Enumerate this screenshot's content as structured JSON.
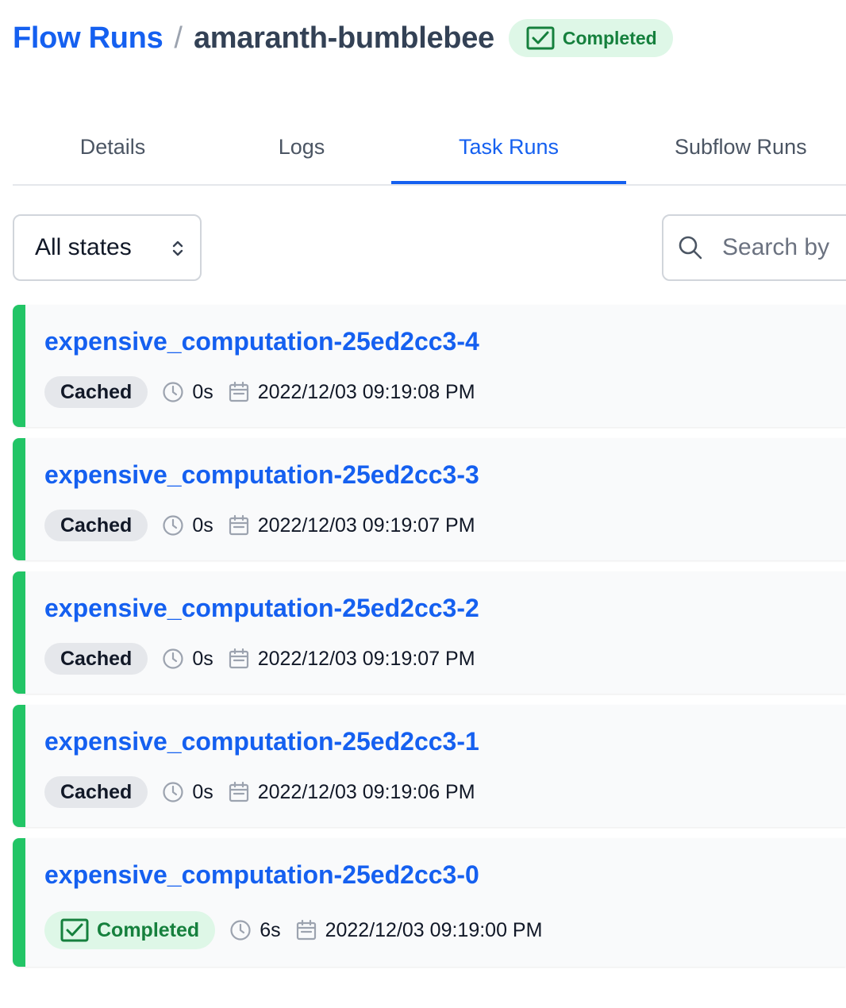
{
  "breadcrumb": {
    "parent": "Flow Runs",
    "separator": "/",
    "current": "amaranth-bumblebee",
    "state": "Completed"
  },
  "tabs": [
    {
      "label": "Details"
    },
    {
      "label": "Logs"
    },
    {
      "label": "Task Runs",
      "active": true
    },
    {
      "label": "Subflow Runs"
    }
  ],
  "filters": {
    "state_select": "All states",
    "search_placeholder": "Search by"
  },
  "task_runs": [
    {
      "name": "expensive_computation-25ed2cc3-4",
      "state": "Cached",
      "duration": "0s",
      "start": "2022/12/03 09:19:08 PM"
    },
    {
      "name": "expensive_computation-25ed2cc3-3",
      "state": "Cached",
      "duration": "0s",
      "start": "2022/12/03 09:19:07 PM"
    },
    {
      "name": "expensive_computation-25ed2cc3-2",
      "state": "Cached",
      "duration": "0s",
      "start": "2022/12/03 09:19:07 PM"
    },
    {
      "name": "expensive_computation-25ed2cc3-1",
      "state": "Cached",
      "duration": "0s",
      "start": "2022/12/03 09:19:06 PM"
    },
    {
      "name": "expensive_computation-25ed2cc3-0",
      "state": "Completed",
      "duration": "6s",
      "start": "2022/12/03 09:19:00 PM"
    }
  ],
  "colors": {
    "accent": "#1560f0",
    "completed_bg": "#def7e7",
    "completed_fg": "#15803d",
    "state_bar": "#22c566",
    "cached_bg": "#e5e7eb"
  },
  "icons": {
    "state_completed": "check-square-icon",
    "select": "chevron-up-down-icon",
    "search": "search-icon",
    "duration": "clock-icon",
    "start_time": "calendar-icon"
  }
}
